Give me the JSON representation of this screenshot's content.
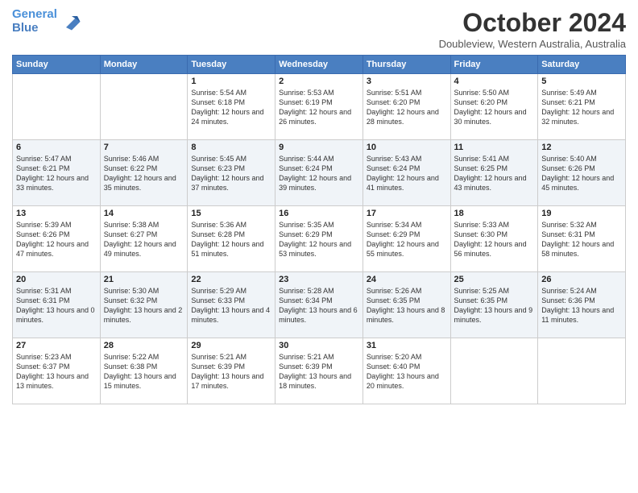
{
  "header": {
    "logo_line1": "General",
    "logo_line2": "Blue",
    "month_title": "October 2024",
    "location": "Doubleview, Western Australia, Australia"
  },
  "days_of_week": [
    "Sunday",
    "Monday",
    "Tuesday",
    "Wednesday",
    "Thursday",
    "Friday",
    "Saturday"
  ],
  "weeks": [
    [
      {
        "day": "",
        "info": ""
      },
      {
        "day": "",
        "info": ""
      },
      {
        "day": "1",
        "info": "Sunrise: 5:54 AM\nSunset: 6:18 PM\nDaylight: 12 hours and 24 minutes."
      },
      {
        "day": "2",
        "info": "Sunrise: 5:53 AM\nSunset: 6:19 PM\nDaylight: 12 hours and 26 minutes."
      },
      {
        "day": "3",
        "info": "Sunrise: 5:51 AM\nSunset: 6:20 PM\nDaylight: 12 hours and 28 minutes."
      },
      {
        "day": "4",
        "info": "Sunrise: 5:50 AM\nSunset: 6:20 PM\nDaylight: 12 hours and 30 minutes."
      },
      {
        "day": "5",
        "info": "Sunrise: 5:49 AM\nSunset: 6:21 PM\nDaylight: 12 hours and 32 minutes."
      }
    ],
    [
      {
        "day": "6",
        "info": "Sunrise: 5:47 AM\nSunset: 6:21 PM\nDaylight: 12 hours and 33 minutes."
      },
      {
        "day": "7",
        "info": "Sunrise: 5:46 AM\nSunset: 6:22 PM\nDaylight: 12 hours and 35 minutes."
      },
      {
        "day": "8",
        "info": "Sunrise: 5:45 AM\nSunset: 6:23 PM\nDaylight: 12 hours and 37 minutes."
      },
      {
        "day": "9",
        "info": "Sunrise: 5:44 AM\nSunset: 6:24 PM\nDaylight: 12 hours and 39 minutes."
      },
      {
        "day": "10",
        "info": "Sunrise: 5:43 AM\nSunset: 6:24 PM\nDaylight: 12 hours and 41 minutes."
      },
      {
        "day": "11",
        "info": "Sunrise: 5:41 AM\nSunset: 6:25 PM\nDaylight: 12 hours and 43 minutes."
      },
      {
        "day": "12",
        "info": "Sunrise: 5:40 AM\nSunset: 6:26 PM\nDaylight: 12 hours and 45 minutes."
      }
    ],
    [
      {
        "day": "13",
        "info": "Sunrise: 5:39 AM\nSunset: 6:26 PM\nDaylight: 12 hours and 47 minutes."
      },
      {
        "day": "14",
        "info": "Sunrise: 5:38 AM\nSunset: 6:27 PM\nDaylight: 12 hours and 49 minutes."
      },
      {
        "day": "15",
        "info": "Sunrise: 5:36 AM\nSunset: 6:28 PM\nDaylight: 12 hours and 51 minutes."
      },
      {
        "day": "16",
        "info": "Sunrise: 5:35 AM\nSunset: 6:29 PM\nDaylight: 12 hours and 53 minutes."
      },
      {
        "day": "17",
        "info": "Sunrise: 5:34 AM\nSunset: 6:29 PM\nDaylight: 12 hours and 55 minutes."
      },
      {
        "day": "18",
        "info": "Sunrise: 5:33 AM\nSunset: 6:30 PM\nDaylight: 12 hours and 56 minutes."
      },
      {
        "day": "19",
        "info": "Sunrise: 5:32 AM\nSunset: 6:31 PM\nDaylight: 12 hours and 58 minutes."
      }
    ],
    [
      {
        "day": "20",
        "info": "Sunrise: 5:31 AM\nSunset: 6:31 PM\nDaylight: 13 hours and 0 minutes."
      },
      {
        "day": "21",
        "info": "Sunrise: 5:30 AM\nSunset: 6:32 PM\nDaylight: 13 hours and 2 minutes."
      },
      {
        "day": "22",
        "info": "Sunrise: 5:29 AM\nSunset: 6:33 PM\nDaylight: 13 hours and 4 minutes."
      },
      {
        "day": "23",
        "info": "Sunrise: 5:28 AM\nSunset: 6:34 PM\nDaylight: 13 hours and 6 minutes."
      },
      {
        "day": "24",
        "info": "Sunrise: 5:26 AM\nSunset: 6:35 PM\nDaylight: 13 hours and 8 minutes."
      },
      {
        "day": "25",
        "info": "Sunrise: 5:25 AM\nSunset: 6:35 PM\nDaylight: 13 hours and 9 minutes."
      },
      {
        "day": "26",
        "info": "Sunrise: 5:24 AM\nSunset: 6:36 PM\nDaylight: 13 hours and 11 minutes."
      }
    ],
    [
      {
        "day": "27",
        "info": "Sunrise: 5:23 AM\nSunset: 6:37 PM\nDaylight: 13 hours and 13 minutes."
      },
      {
        "day": "28",
        "info": "Sunrise: 5:22 AM\nSunset: 6:38 PM\nDaylight: 13 hours and 15 minutes."
      },
      {
        "day": "29",
        "info": "Sunrise: 5:21 AM\nSunset: 6:39 PM\nDaylight: 13 hours and 17 minutes."
      },
      {
        "day": "30",
        "info": "Sunrise: 5:21 AM\nSunset: 6:39 PM\nDaylight: 13 hours and 18 minutes."
      },
      {
        "day": "31",
        "info": "Sunrise: 5:20 AM\nSunset: 6:40 PM\nDaylight: 13 hours and 20 minutes."
      },
      {
        "day": "",
        "info": ""
      },
      {
        "day": "",
        "info": ""
      }
    ]
  ]
}
